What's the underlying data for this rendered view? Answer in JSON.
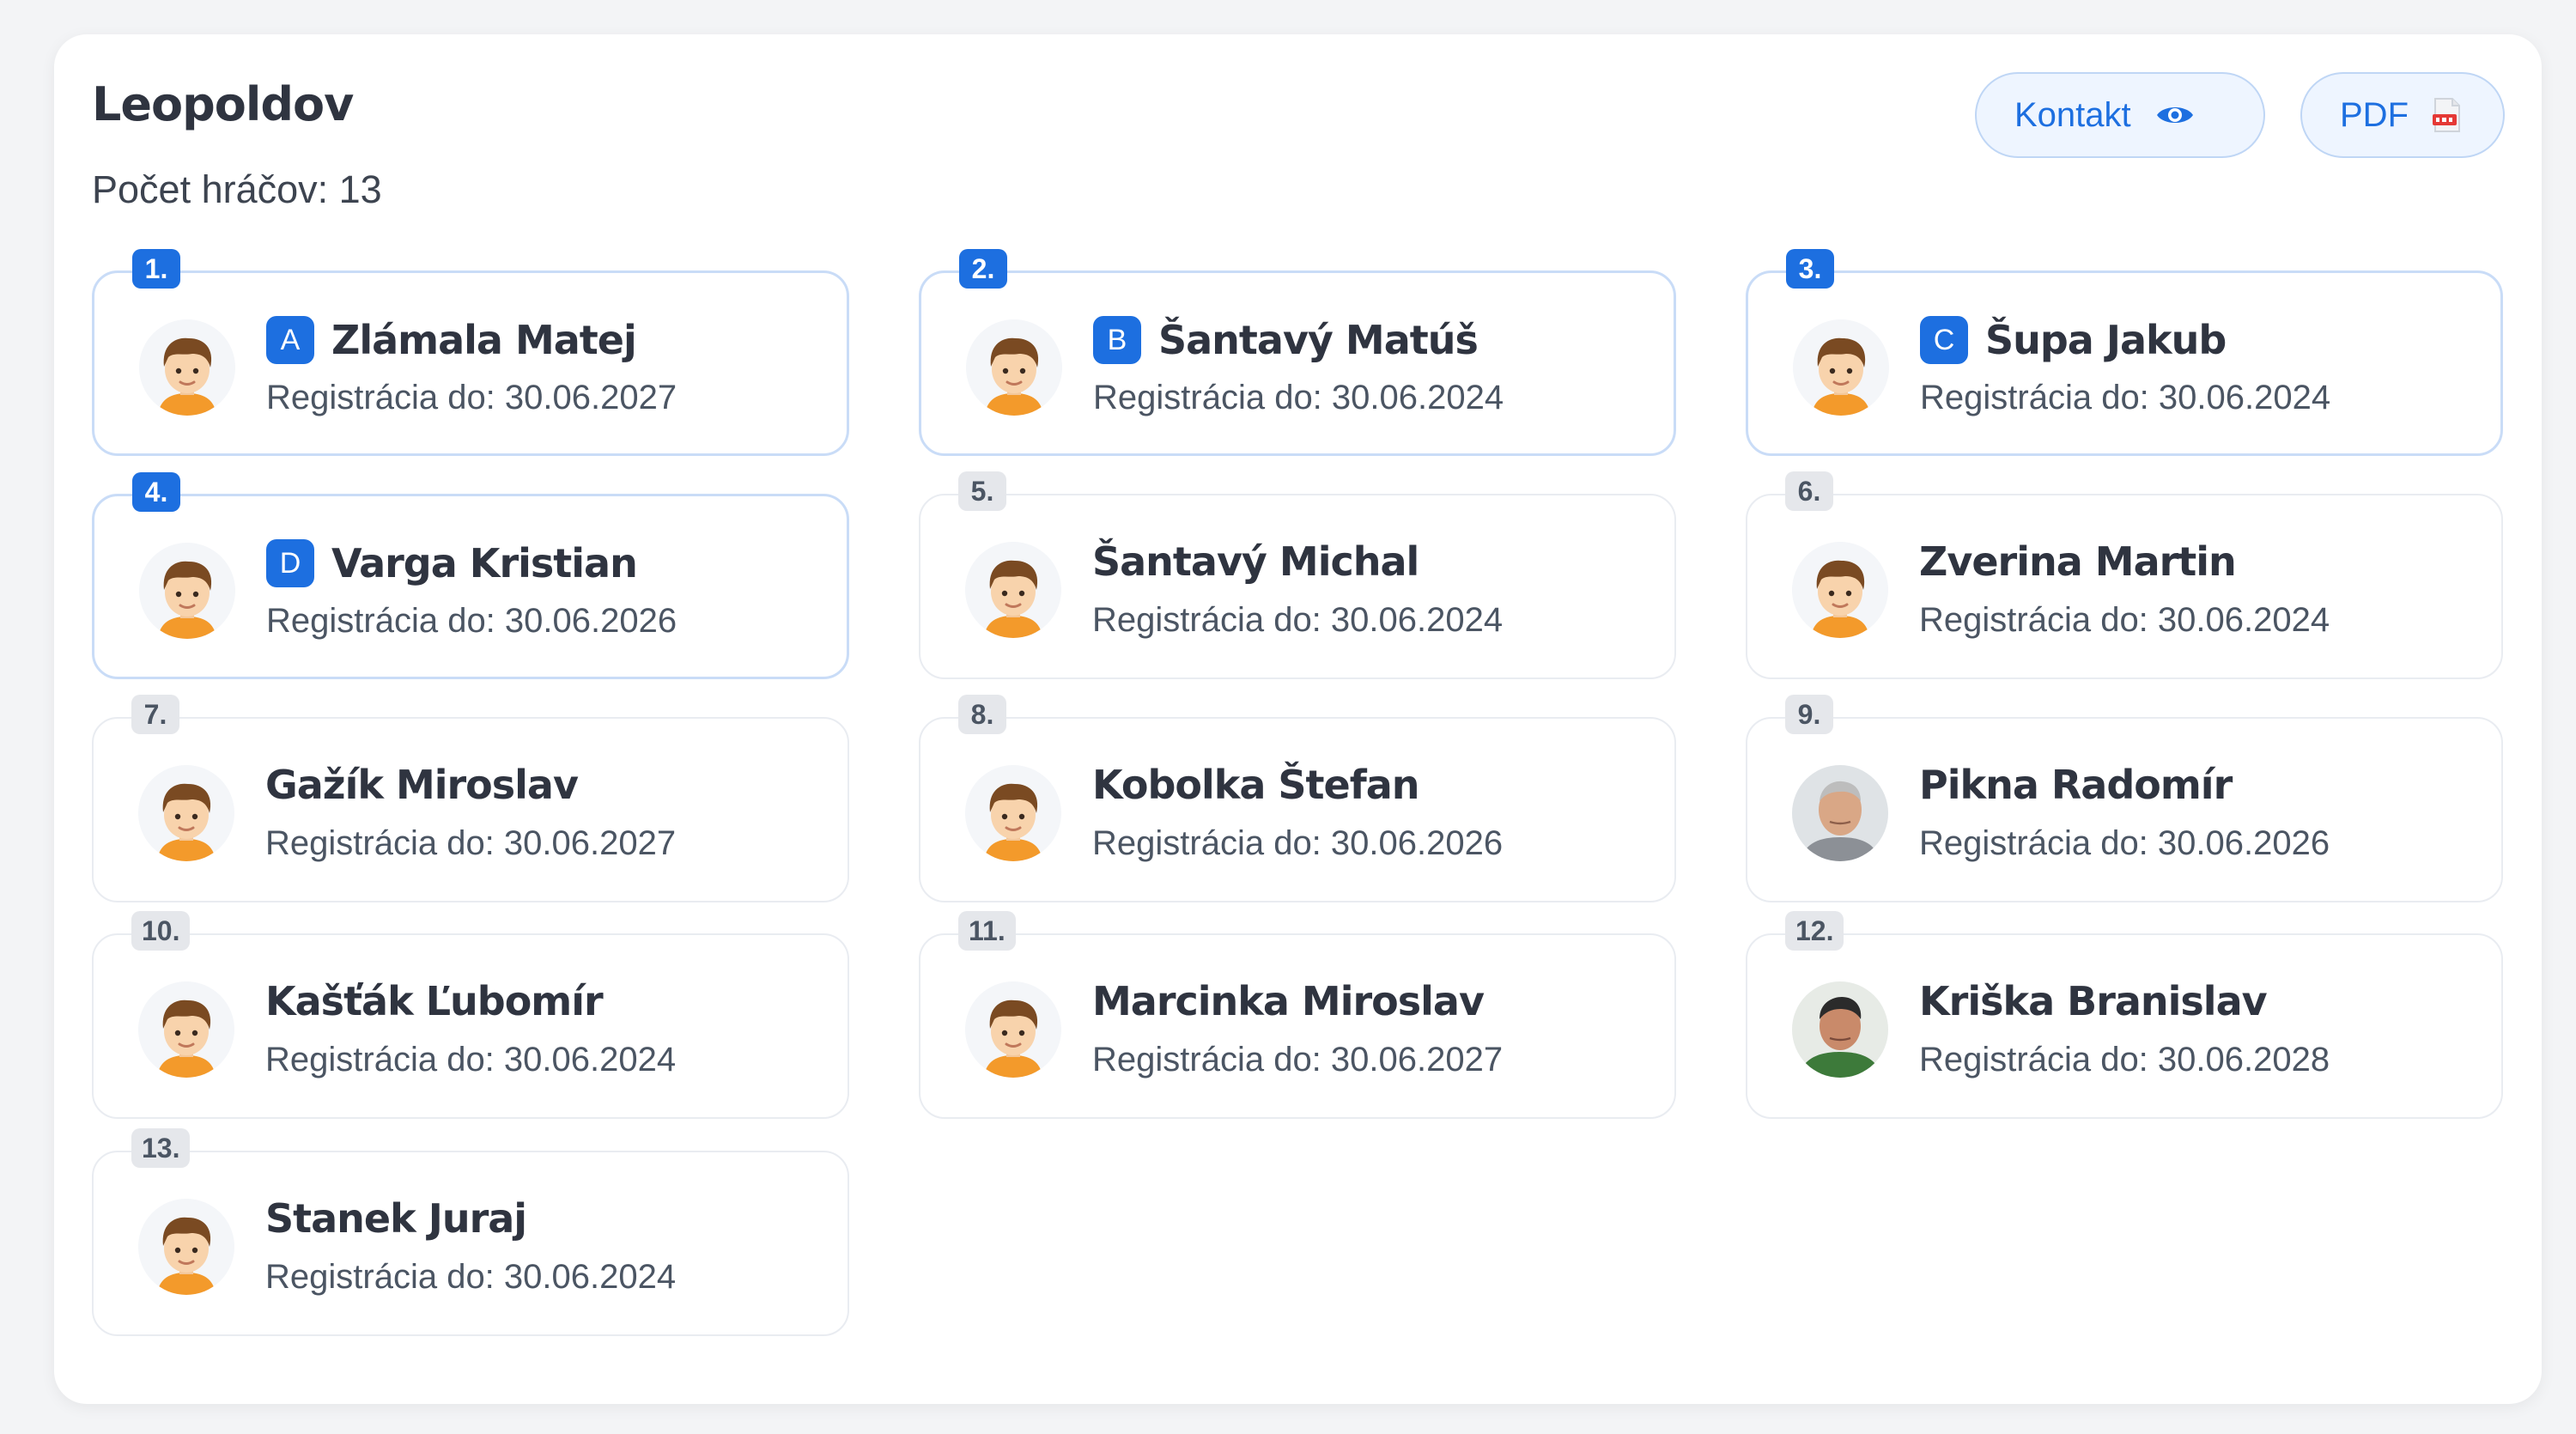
{
  "header": {
    "title": "Leopoldov",
    "count_text": "Počet hráčov: 13",
    "contact_label": "Kontakt",
    "pdf_label": "PDF"
  },
  "colors": {
    "accent": "#1d6fe0",
    "accent_light": "#eef5ff",
    "text_dark": "#2f3440",
    "badge_gray": "#e5e7eb"
  },
  "players": [
    {
      "number": "1.",
      "letter": "A",
      "name": "Zlámala Matej",
      "registration": "Registrácia do: 30.06.2027",
      "highlighted": true,
      "avatar": "cartoon"
    },
    {
      "number": "2.",
      "letter": "B",
      "name": "Šantavý Matúš",
      "registration": "Registrácia do: 30.06.2024",
      "highlighted": true,
      "avatar": "cartoon"
    },
    {
      "number": "3.",
      "letter": "C",
      "name": "Šupa Jakub",
      "registration": "Registrácia do: 30.06.2024",
      "highlighted": true,
      "avatar": "cartoon"
    },
    {
      "number": "4.",
      "letter": "D",
      "name": "Varga Kristian",
      "registration": "Registrácia do: 30.06.2026",
      "highlighted": true,
      "avatar": "cartoon"
    },
    {
      "number": "5.",
      "letter": "",
      "name": "Šantavý Michal",
      "registration": "Registrácia do: 30.06.2024",
      "highlighted": false,
      "avatar": "cartoon"
    },
    {
      "number": "6.",
      "letter": "",
      "name": "Zverina Martin",
      "registration": "Registrácia do: 30.06.2024",
      "highlighted": false,
      "avatar": "cartoon"
    },
    {
      "number": "7.",
      "letter": "",
      "name": "Gažík Miroslav",
      "registration": "Registrácia do: 30.06.2027",
      "highlighted": false,
      "avatar": "cartoon"
    },
    {
      "number": "8.",
      "letter": "",
      "name": "Kobolka Štefan",
      "registration": "Registrácia do: 30.06.2026",
      "highlighted": false,
      "avatar": "cartoon"
    },
    {
      "number": "9.",
      "letter": "",
      "name": "Pikna Radomír",
      "registration": "Registrácia do: 30.06.2026",
      "highlighted": false,
      "avatar": "photo-gray"
    },
    {
      "number": "10.",
      "letter": "",
      "name": "Kašťák Ľubomír",
      "registration": "Registrácia do: 30.06.2024",
      "highlighted": false,
      "avatar": "cartoon"
    },
    {
      "number": "11.",
      "letter": "",
      "name": "Marcinka Miroslav",
      "registration": "Registrácia do: 30.06.2027",
      "highlighted": false,
      "avatar": "cartoon"
    },
    {
      "number": "12.",
      "letter": "",
      "name": "Kriška Branislav",
      "registration": "Registrácia do: 30.06.2028",
      "highlighted": false,
      "avatar": "photo-green"
    },
    {
      "number": "13.",
      "letter": "",
      "name": "Stanek Juraj",
      "registration": "Registrácia do: 30.06.2024",
      "highlighted": false,
      "avatar": "cartoon"
    }
  ]
}
